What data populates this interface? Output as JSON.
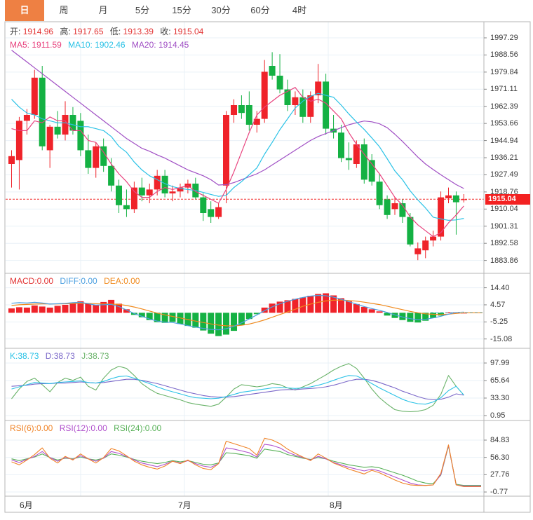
{
  "tabbar": {
    "tabs": [
      "日",
      "周",
      "月",
      "5分",
      "15分",
      "30分",
      "60分",
      "4时"
    ],
    "active_index": 0
  },
  "main": {
    "info": {
      "open_label": "开:",
      "open": "1914.96",
      "high_label": "高:",
      "high": "1917.65",
      "low_label": "低:",
      "low": "1913.39",
      "close_label": "收:",
      "close": "1915.04"
    },
    "ma_labels": {
      "ma5": "MA5: 1911.59",
      "ma10": "MA10: 1902.46",
      "ma20": "MA20: 1914.45"
    },
    "badge": "1915.04"
  },
  "macd_header": {
    "macd": "MACD:0.00",
    "diff": "DIFF:0.00",
    "dea": "DEA:0.00"
  },
  "kdj_header": {
    "k": "K:38.73",
    "d": "D:38.73",
    "j": "J:38.73"
  },
  "rsi_header": {
    "rsi6": "RSI(6):0.00",
    "rsi12": "RSI(12):0.00",
    "rsi24": "RSI(24):0.00"
  },
  "colors": {
    "up": "#ef232a",
    "down": "#14b143",
    "ma5": "#e8437e",
    "ma10": "#2bc2e6",
    "ma20": "#a04fc4",
    "diff": "#4b9fe0",
    "dea": "#f08a1d",
    "diff_ext": "#86d3ee",
    "k": "#2bc2e6",
    "d": "#7b68c9",
    "j": "#6ab36a",
    "rsi6": "#f08428",
    "rsi12": "#b050cc",
    "rsi24": "#58b158",
    "price_line": "#f12b2b",
    "badge_bg": "#f32121",
    "tab_active_bg": "#ee8043",
    "grid": "#e9f1f7",
    "border": "#b5b5b5",
    "tick": "#888888"
  },
  "chart_data": {
    "main": {
      "type": "candlestick",
      "title": "",
      "current_price": 1915.04,
      "ylim": [
        1880,
        2001
      ],
      "axis_ticks": [
        "1997.29",
        "1988.56",
        "1979.84",
        "1971.11",
        "1962.39",
        "1953.66",
        "1944.94",
        "1936.21",
        "1927.49",
        "1918.76",
        "1910.04",
        "1901.31",
        "1892.58",
        "1883.86"
      ],
      "candles": [
        [
          1933,
          1940,
          1921,
          1937
        ],
        [
          1935,
          1957,
          1920,
          1955
        ],
        [
          1955,
          1961,
          1948,
          1958
        ],
        [
          1958,
          1981,
          1956,
          1977
        ],
        [
          1977,
          1983,
          1940,
          1942
        ],
        [
          1940,
          1953,
          1931,
          1952
        ],
        [
          1952,
          1960,
          1946,
          1948
        ],
        [
          1948,
          1965,
          1945,
          1958
        ],
        [
          1958,
          1962,
          1948,
          1950
        ],
        [
          1955,
          1959,
          1937,
          1940
        ],
        [
          1940,
          1948,
          1928,
          1931
        ],
        [
          1931,
          1944,
          1926,
          1942
        ],
        [
          1942,
          1946,
          1929,
          1932
        ],
        [
          1932,
          1936,
          1919,
          1922
        ],
        [
          1922,
          1925,
          1908,
          1912
        ],
        [
          1912,
          1920,
          1906,
          1910
        ],
        [
          1910,
          1924,
          1908,
          1921
        ],
        [
          1921,
          1926,
          1914,
          1917
        ],
        [
          1917,
          1923,
          1913,
          1920
        ],
        [
          1920,
          1930,
          1917,
          1927
        ],
        [
          1927,
          1930,
          1916,
          1918
        ],
        [
          1918,
          1922,
          1914,
          1919
        ],
        [
          1919,
          1923,
          1916,
          1921
        ],
        [
          1921,
          1925,
          1918,
          1923
        ],
        [
          1923,
          1926,
          1915,
          1916
        ],
        [
          1916,
          1918,
          1904,
          1908
        ],
        [
          1910,
          1914,
          1903,
          1906
        ],
        [
          1906,
          1913,
          1905,
          1911
        ],
        [
          1922,
          1960,
          1913,
          1958
        ],
        [
          1958,
          1966,
          1954,
          1963
        ],
        [
          1963,
          1968,
          1956,
          1959
        ],
        [
          1963,
          1970,
          1950,
          1953
        ],
        [
          1953,
          1960,
          1949,
          1956
        ],
        [
          1956,
          1986,
          1954,
          1980
        ],
        [
          1983,
          1990,
          1976,
          1978
        ],
        [
          1978,
          1989,
          1969,
          1971
        ],
        [
          1971,
          1976,
          1960,
          1963
        ],
        [
          1963,
          1970,
          1958,
          1967
        ],
        [
          1967,
          1971,
          1954,
          1957
        ],
        [
          1957,
          1970,
          1954,
          1968
        ],
        [
          1968,
          1984,
          1964,
          1975
        ],
        [
          1975,
          1979,
          1948,
          1951
        ],
        [
          1951,
          1958,
          1946,
          1949
        ],
        [
          1949,
          1953,
          1934,
          1936
        ],
        [
          1936,
          1944,
          1930,
          1935
        ],
        [
          1933,
          1945,
          1931,
          1943
        ],
        [
          1943,
          1946,
          1923,
          1925
        ],
        [
          1935,
          1938,
          1922,
          1924
        ],
        [
          1924,
          1928,
          1910,
          1912
        ],
        [
          1915,
          1917,
          1905,
          1907
        ],
        [
          1910,
          1916,
          1907,
          1913
        ],
        [
          1913,
          1915,
          1903,
          1906
        ],
        [
          1906,
          1908,
          1891,
          1892
        ],
        [
          1887,
          1893,
          1884,
          1890
        ],
        [
          1889,
          1896,
          1885,
          1894
        ],
        [
          1894,
          1899,
          1891,
          1896
        ],
        [
          1896,
          1919,
          1894,
          1916
        ],
        [
          1915.5,
          1921,
          1913,
          1917
        ],
        [
          1917,
          1919,
          1897,
          1913.5
        ],
        [
          1914.96,
          1917.65,
          1913.39,
          1915.04
        ]
      ],
      "ma5": [
        1951,
        1950,
        1950,
        1955,
        1954,
        1957,
        1955,
        1955,
        1950,
        1950,
        1945,
        1944,
        1939,
        1933,
        1928,
        1924,
        1919,
        1916,
        1916,
        1919,
        1921,
        1920,
        1921,
        1922,
        1919,
        1917,
        1915,
        1913,
        1920,
        1929,
        1939,
        1949,
        1958,
        1962,
        1965,
        1968,
        1970,
        1972,
        1967,
        1965,
        1966,
        1964,
        1960,
        1956,
        1949,
        1943,
        1938,
        1933,
        1928,
        1922,
        1916,
        1912,
        1906,
        1902,
        1899,
        1896,
        1898,
        1903,
        1907,
        1911.6
      ],
      "ma10": [
        1966,
        1962,
        1959,
        1958,
        1956,
        1955,
        1954,
        1954,
        1953,
        1952,
        1952,
        1951,
        1950,
        1947,
        1942,
        1939,
        1934,
        1930,
        1927,
        1925,
        1923,
        1921.5,
        1920.5,
        1920,
        1919.5,
        1918.5,
        1917.5,
        1916.5,
        1917,
        1921,
        1924,
        1927.5,
        1931,
        1938,
        1944,
        1950.5,
        1956,
        1961.5,
        1965,
        1967.5,
        1969,
        1968,
        1967,
        1963,
        1958.5,
        1954.4,
        1950.6,
        1946.3,
        1941.8,
        1935.7,
        1929.5,
        1925,
        1919.3,
        1914.7,
        1910.6,
        1905.9,
        1905,
        1904.3,
        1904.5,
        1905.3
      ],
      "ma20": [
        1991,
        1988,
        1985,
        1982,
        1979,
        1976,
        1973,
        1970,
        1967,
        1964,
        1961,
        1958,
        1955,
        1952,
        1949,
        1946,
        1943.5,
        1941,
        1939.5,
        1937.6,
        1936,
        1934,
        1932,
        1930,
        1928.5,
        1927,
        1925,
        1922.3,
        1922.5,
        1923.5,
        1925,
        1926.5,
        1928,
        1930,
        1932.5,
        1935,
        1937.5,
        1940,
        1942.5,
        1945,
        1947,
        1948.5,
        1950,
        1951.5,
        1953,
        1954,
        1954.9,
        1954.5,
        1953.5,
        1951.5,
        1948.2,
        1944.5,
        1940.5,
        1936.5,
        1933,
        1930.2,
        1927.5,
        1925,
        1922.5,
        1920.5
      ]
    },
    "macd": {
      "type": "bar",
      "axis_ticks": [
        "14.40",
        "4.57",
        "-5.25",
        "-15.08"
      ],
      "histogram": [
        2.5,
        3.2,
        3.0,
        4.2,
        3.6,
        3.0,
        4.0,
        4.6,
        5.8,
        6.6,
        5.4,
        4.6,
        6.2,
        7.4,
        5.2,
        2.0,
        -1.2,
        -2.6,
        -4.2,
        -5.4,
        -5.8,
        -5.2,
        -6.4,
        -7.6,
        -8.6,
        -10.2,
        -12.0,
        -13.4,
        -12.6,
        -10.4,
        -7.0,
        -3.6,
        -0.8,
        3.0,
        5.3,
        6.4,
        7.2,
        8.0,
        8.8,
        9.8,
        10.8,
        11.2,
        10.0,
        8.4,
        6.6,
        5.0,
        3.4,
        2.0,
        0.8,
        -1.6,
        -3.0,
        -4.2,
        -5.2,
        -5.6,
        -4.6,
        -3.0,
        -1.6,
        0.4,
        0.3,
        0.1
      ],
      "diff": [
        5.5,
        5.8,
        5.6,
        6.0,
        5.6,
        5.0,
        5.2,
        5.4,
        5.8,
        6.0,
        5.2,
        4.4,
        4.6,
        4.8,
        3.6,
        1.6,
        -0.4,
        -2.0,
        -3.6,
        -4.8,
        -5.4,
        -5.6,
        -6.4,
        -7.4,
        -8.2,
        -9.0,
        -9.6,
        -9.8,
        -9.2,
        -7.8,
        -5.8,
        -3.6,
        -1.2,
        1.2,
        3.4,
        5.2,
        6.6,
        7.8,
        8.8,
        9.6,
        10.0,
        9.8,
        9.0,
        7.8,
        6.4,
        5.0,
        3.6,
        2.4,
        1.4,
        0.2,
        -1.2,
        -2.4,
        -3.4,
        -4.0,
        -3.8,
        -3.0,
        -2.0,
        -0.8,
        0.2,
        0.4
      ],
      "dea": [
        4.2,
        4.6,
        4.8,
        5.0,
        5.1,
        5.1,
        5.1,
        5.2,
        5.3,
        5.4,
        5.4,
        5.2,
        5.1,
        5.0,
        4.8,
        4.2,
        3.3,
        2.2,
        1.0,
        -0.2,
        -1.2,
        -2.1,
        -3.0,
        -3.9,
        -4.8,
        -5.6,
        -6.4,
        -7.1,
        -7.5,
        -7.6,
        -7.2,
        -6.5,
        -5.4,
        -4.1,
        -2.6,
        -1.0,
        0.5,
        2.0,
        3.7,
        5.0,
        6.0,
        6.8,
        7.2,
        7.3,
        7.1,
        6.7,
        6.1,
        5.4,
        4.7,
        3.8,
        2.8,
        1.8,
        0.8,
        0.0,
        -0.6,
        -0.9,
        -1.0,
        -0.8,
        -0.4,
        0.0
      ]
    },
    "kdj": {
      "type": "line",
      "axis_ticks": [
        "97.99",
        "65.64",
        "33.30",
        "0.95"
      ],
      "k": [
        50,
        54,
        58,
        62,
        61,
        60,
        62,
        63,
        64,
        65,
        62,
        61,
        64,
        69,
        73,
        74,
        70,
        65,
        60,
        54,
        49,
        45,
        41,
        37,
        34,
        33,
        32,
        33,
        36,
        40,
        44,
        46,
        48,
        50,
        52,
        53,
        52,
        51,
        52,
        54,
        57,
        61,
        66,
        71,
        75,
        74,
        68,
        60,
        52,
        45,
        38,
        31,
        26,
        23,
        22,
        26,
        34,
        47,
        55,
        38.7
      ],
      "d": [
        55,
        56,
        57,
        59,
        60,
        60,
        61,
        61,
        62,
        63,
        62,
        61,
        62,
        64,
        66,
        68,
        68,
        66,
        63,
        60,
        56,
        52,
        48,
        44,
        41,
        38,
        36,
        35,
        35,
        36,
        38,
        40,
        42,
        44,
        46,
        48,
        49,
        49,
        50,
        51,
        52,
        54,
        57,
        61,
        65,
        68,
        68,
        66,
        62,
        57,
        52,
        46,
        41,
        36,
        32,
        30,
        31,
        35,
        41,
        38.7
      ],
      "j": [
        32,
        50,
        64,
        70,
        58,
        45,
        62,
        70,
        66,
        72,
        55,
        48,
        70,
        85,
        92,
        88,
        75,
        60,
        50,
        42,
        38,
        34,
        30,
        25,
        22,
        20,
        18,
        22,
        35,
        50,
        58,
        56,
        54,
        56,
        60,
        58,
        52,
        48,
        54,
        60,
        68,
        76,
        85,
        92,
        97,
        88,
        70,
        50,
        34,
        22,
        12,
        9,
        8,
        9,
        12,
        20,
        40,
        75,
        55,
        38.7
      ]
    },
    "rsi": {
      "type": "line",
      "axis_ticks": [
        "84.83",
        "56.30",
        "27.76",
        "-0.77"
      ],
      "rsi6": [
        49,
        44,
        52,
        61,
        72,
        55,
        47,
        58,
        52,
        62,
        54,
        47,
        56,
        71,
        67,
        59,
        50,
        44,
        40,
        37,
        42,
        50,
        46,
        52,
        44,
        38,
        36,
        46,
        83,
        79,
        75,
        71,
        60,
        88,
        85,
        79,
        70,
        63,
        57,
        51,
        62,
        55,
        47,
        42,
        37,
        33,
        29,
        35,
        31,
        25,
        19,
        14,
        11,
        10,
        10,
        11,
        30,
        77,
        11,
        8
      ],
      "rsi12": [
        52,
        48,
        53,
        58,
        66,
        56,
        50,
        56,
        53,
        59,
        54,
        50,
        55,
        66,
        63,
        58,
        52,
        47,
        44,
        41,
        45,
        50,
        47,
        51,
        46,
        42,
        40,
        46,
        72,
        70,
        67,
        64,
        57,
        78,
        76,
        72,
        65,
        60,
        56,
        52,
        58,
        54,
        48,
        44,
        40,
        37,
        34,
        37,
        34,
        29,
        24,
        19,
        14,
        11,
        10,
        11,
        28,
        76,
        11,
        9
      ],
      "rsi24": [
        54,
        51,
        54,
        57,
        62,
        56,
        52,
        55,
        54,
        57,
        54,
        52,
        55,
        62,
        60,
        57,
        53,
        50,
        48,
        46,
        48,
        51,
        49,
        51,
        48,
        45,
        44,
        47,
        64,
        63,
        61,
        59,
        55,
        70,
        68,
        66,
        61,
        58,
        55,
        53,
        56,
        54,
        50,
        47,
        44,
        42,
        40,
        41,
        39,
        35,
        31,
        27,
        22,
        17,
        14,
        13,
        27,
        75,
        12,
        10
      ]
    },
    "x_months": [
      {
        "label": "6月",
        "x": 28
      },
      {
        "label": "7月",
        "x": 254
      },
      {
        "label": "8月",
        "x": 470
      }
    ],
    "gridline_x": [
      115,
      263,
      468
    ]
  }
}
